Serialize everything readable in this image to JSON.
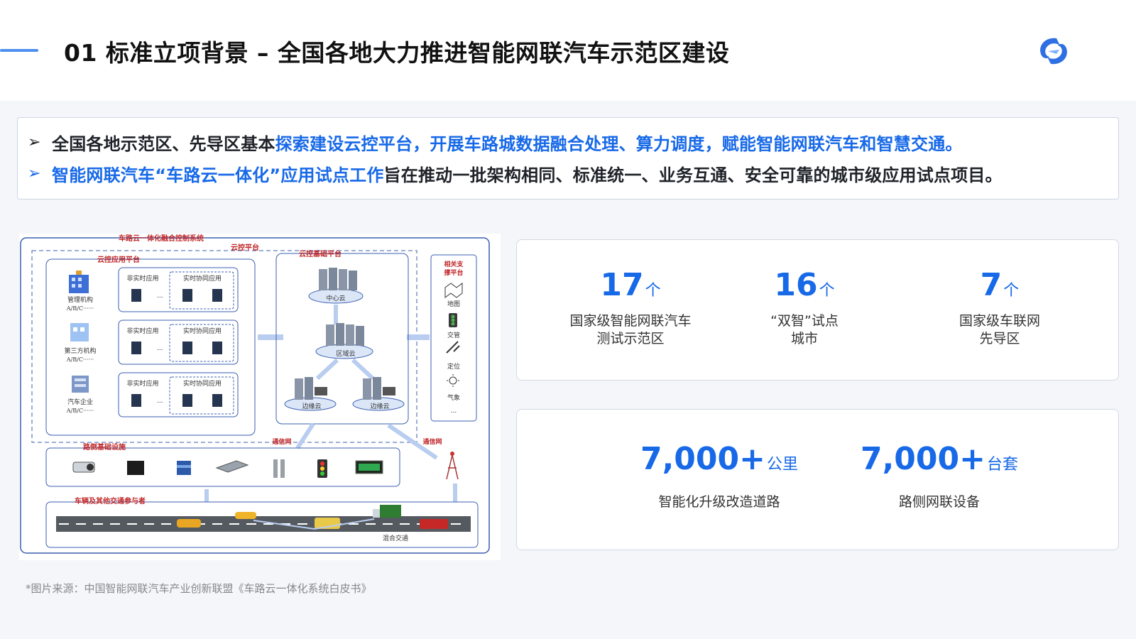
{
  "header": {
    "title": "01 标准立项背景 – 全国各地大力推进智能网联汽车示范区建设",
    "logo_icon": "brand-logo-icon"
  },
  "intro": {
    "line1": {
      "prefix": "全国各地示范区、先导区基本",
      "highlight": "探索建设云控平台，开展车路城数据融合处理、算力调度，赋能智能网联汽车和智慧交通。"
    },
    "line2": {
      "highlight": "智能网联汽车“车路云一体化”应用试点工作",
      "suffix": "旨在推动一批架构相同、标准统一、业务互通、安全可靠的城市级应用试点项目。"
    }
  },
  "diagram": {
    "outer_title": "车路云一体化融合控制系统",
    "cloud_platform": "云控平台",
    "app_platform": "云控应用平台",
    "base_platform": "云控基础平台",
    "support_platform": "相关支撑平台",
    "orgs": [
      "管理机构",
      "第三方机构",
      "汽车企业"
    ],
    "org_suffix": "A/B/C······",
    "app_rows": [
      {
        "left": "非实时应用",
        "right": "实时协同应用"
      },
      {
        "left": "非实时应用",
        "right": "实时协同应用"
      },
      {
        "left": "非实时应用",
        "right": "实时协同应用"
      }
    ],
    "clouds": {
      "center": "中心云",
      "region": "区域云",
      "edge1": "边缘云",
      "edge2": "边缘云"
    },
    "supports": [
      "地图",
      "交管",
      "定位",
      "气象",
      "..."
    ],
    "comm_net_1": "通信网",
    "comm_net_2": "通信网",
    "roadside": "路侧基础设施",
    "vehicles": "车辆及其他交通参与者",
    "mixed_traffic": "混合交通"
  },
  "stats_top": [
    {
      "num": "17",
      "unit": "个",
      "desc1": "国家级智能网联汽车",
      "desc2": "测试示范区"
    },
    {
      "num": "16",
      "unit": "个",
      "desc1": "“双智”试点",
      "desc2": "城市"
    },
    {
      "num": "7",
      "unit": "个",
      "desc1": "国家级车联网",
      "desc2": "先导区"
    }
  ],
  "stats_bottom": [
    {
      "num": "7,000+",
      "unit": "公里",
      "desc1": "智能化升级改造道路"
    },
    {
      "num": "7,000+",
      "unit": "台套",
      "desc1": "路侧网联设备"
    }
  ],
  "footnote": "*图片来源：中国智能网联汽车产业创新联盟《车路云一体化系统白皮书》",
  "colors": {
    "accent": "#1769e8",
    "diagram_line": "#3b5fb0",
    "title_red": "#c0282a"
  }
}
